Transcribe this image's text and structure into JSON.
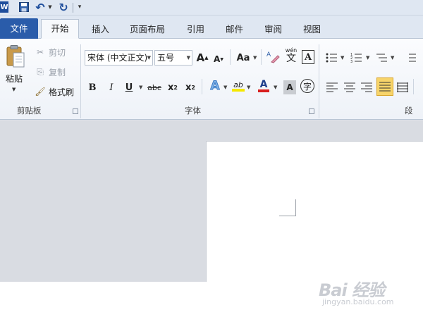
{
  "tabs": {
    "file": "文件",
    "home": "开始",
    "insert": "插入",
    "page_layout": "页面布局",
    "references": "引用",
    "mailings": "邮件",
    "review": "审阅",
    "view": "视图"
  },
  "clipboard": {
    "paste": "粘贴",
    "cut": "剪切",
    "copy": "复制",
    "format_painter": "格式刷",
    "group_label": "剪贴板"
  },
  "font": {
    "font_name": "宋体 (中文正文)",
    "font_size": "五号",
    "grow_font": "A",
    "shrink_font": "A",
    "change_case": "Aa",
    "phonetic": "wén",
    "phonetic_char": "文",
    "char_border": "A",
    "bold": "B",
    "italic": "I",
    "underline": "U",
    "strikethrough": "abc",
    "subscript_base": "x",
    "subscript_mark": "2",
    "superscript_base": "x",
    "superscript_mark": "2",
    "text_effect": "A",
    "highlight": "ab",
    "font_color": "A",
    "char_shading": "A",
    "enclose": "字",
    "group_label": "字体"
  },
  "paragraph": {
    "group_label": "段"
  },
  "watermark": {
    "logo": "Bai 经验",
    "url": "jingyan.baidu.com"
  },
  "colors": {
    "accent": "#2a5caa",
    "font_color_bar": "#d81e1e",
    "highlight_bar": "#f5e800"
  }
}
